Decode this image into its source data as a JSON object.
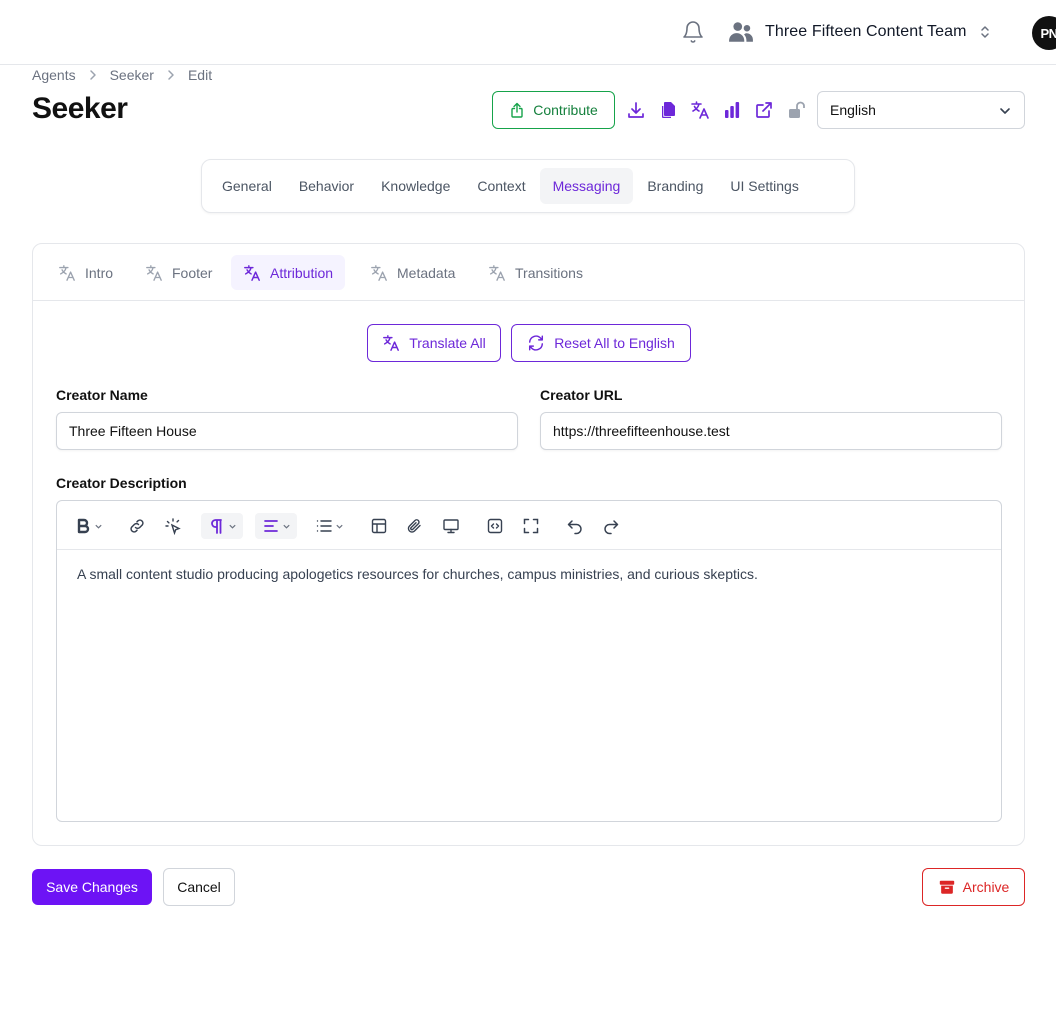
{
  "topbar": {
    "team_name": "Three Fifteen Content Team",
    "avatar_initials": "PN"
  },
  "breadcrumb": [
    "Agents",
    "Seeker",
    "Edit"
  ],
  "page": {
    "title": "Seeker",
    "contribute_label": "Contribute",
    "language_value": "English"
  },
  "header_icons": [
    "download-icon",
    "copy-icon",
    "translate-icon",
    "chart-icon",
    "external-link-icon",
    "unlock-icon"
  ],
  "main_tabs": {
    "general": "General",
    "behavior": "Behavior",
    "knowledge": "Knowledge",
    "context": "Context",
    "messaging": "Messaging",
    "branding": "Branding",
    "ui_settings": "UI Settings",
    "active": "Messaging"
  },
  "sub_tabs": {
    "intro": "Intro",
    "footer": "Footer",
    "attribution": "Attribution",
    "metadata": "Metadata",
    "transitions": "Transitions",
    "active": "Attribution"
  },
  "actions": {
    "translate_all": "Translate All",
    "reset_all": "Reset All to English"
  },
  "form": {
    "creator_name_label": "Creator Name",
    "creator_name_value": "Three Fifteen House",
    "creator_url_label": "Creator URL",
    "creator_url_value": "https://threefifteenhouse.test",
    "creator_description_label": "Creator Description",
    "creator_description_value": "A small content studio producing apologetics resources for churches, campus ministries, and curious skeptics."
  },
  "editor_toolbar": [
    "bold-icon",
    "link-icon",
    "clear-format-icon",
    "paragraph-icon",
    "align-left-icon",
    "list-icon",
    "table-icon",
    "attachment-icon",
    "monitor-icon",
    "code-icon",
    "fullscreen-icon",
    "undo-icon",
    "redo-icon"
  ],
  "footer": {
    "save_label": "Save Changes",
    "cancel_label": "Cancel",
    "archive_label": "Archive"
  },
  "colors": {
    "accent": "#6d28d9",
    "primary_button": "#6d13f5",
    "success": "#16a34a",
    "danger": "#dc2626"
  }
}
